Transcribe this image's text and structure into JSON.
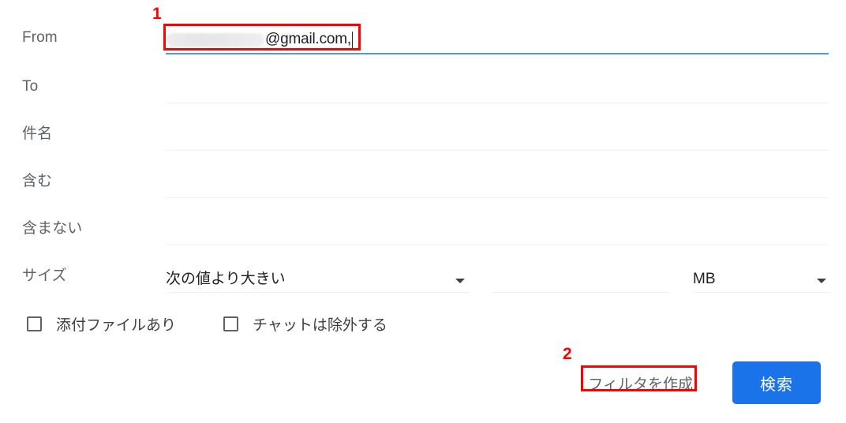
{
  "dialog": {
    "name": "gmail-advanced-search"
  },
  "fields": {
    "from": {
      "label": "From",
      "value": "@gmail.com,",
      "redacted": true,
      "focused": true
    },
    "to": {
      "label": "To",
      "value": ""
    },
    "subject": {
      "label": "件名",
      "value": ""
    },
    "has_words": {
      "label": "含む",
      "value": ""
    },
    "not_has_words": {
      "label": "含まない",
      "value": ""
    },
    "size": {
      "label": "サイズ",
      "operator": "次の値より大きい",
      "number": "",
      "unit": "MB",
      "arrow_icon": "chevron-down-icon"
    }
  },
  "checkboxes": [
    {
      "label": "添付ファイルあり",
      "checked": false
    },
    {
      "label": "チャットは除外する",
      "checked": false
    }
  ],
  "actions": {
    "create_filter_label": "フィルタを作成",
    "search_label": "検索"
  },
  "annotations": [
    {
      "number": "1",
      "target": "from-field"
    },
    {
      "number": "2",
      "target": "create-filter-button"
    }
  ],
  "colors": {
    "primary_blue": "#1a73e8",
    "focus_underline": "#5490f5",
    "annotation_red": "#ff0000",
    "label_grey": "#5f6368",
    "underline_grey": "#f1f1f1"
  }
}
